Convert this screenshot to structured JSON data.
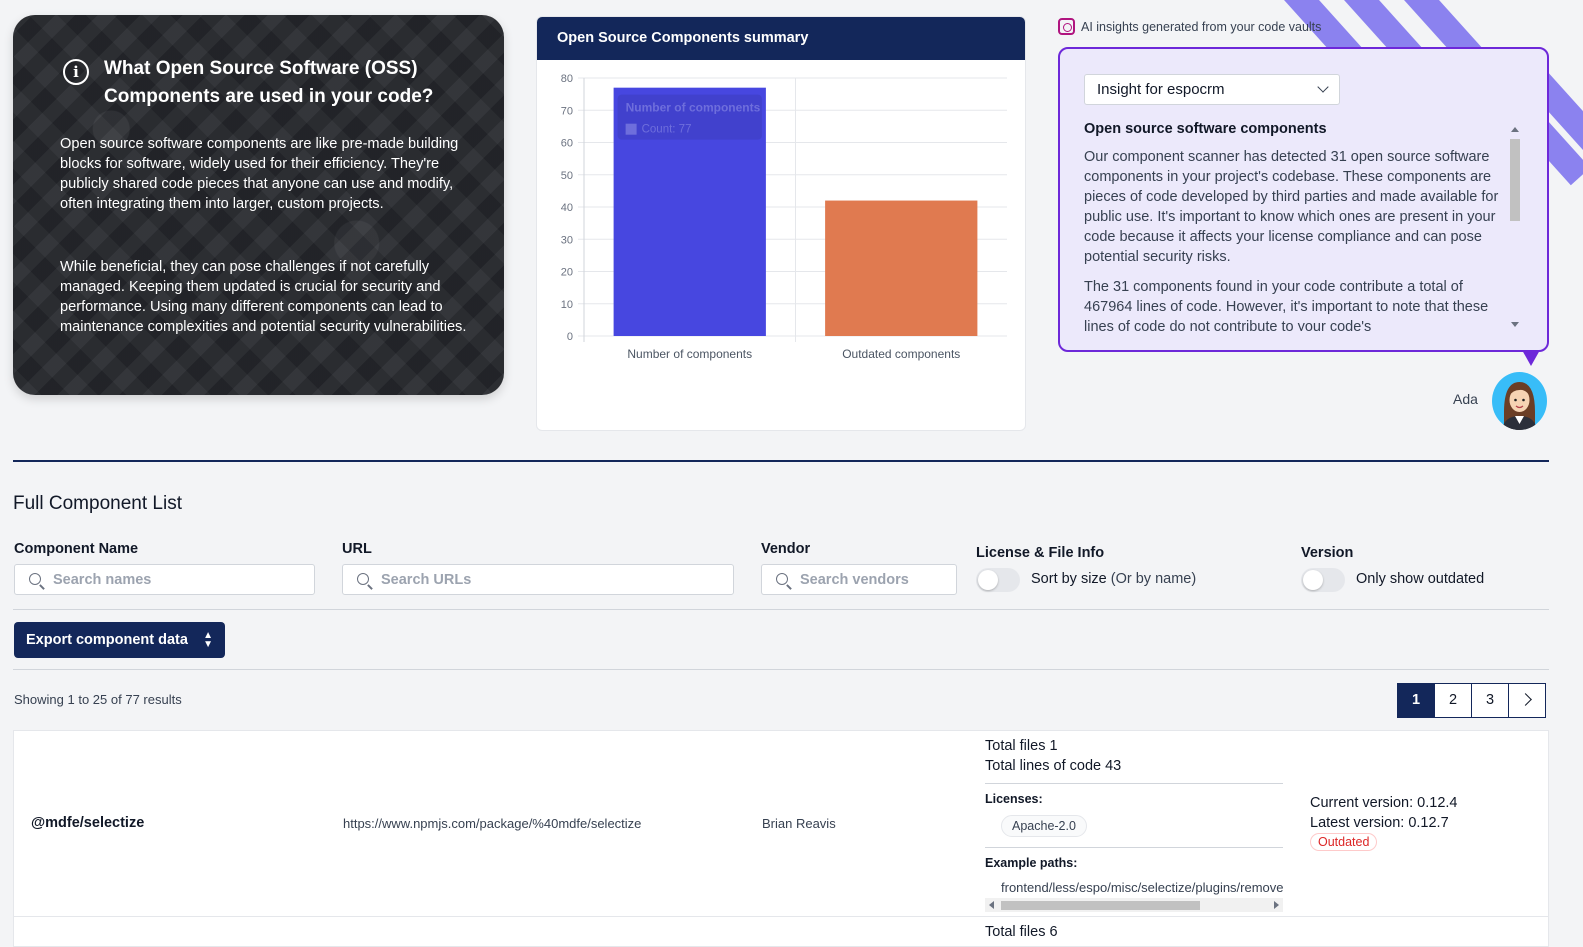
{
  "oss_card": {
    "title": "What Open Source Software (OSS) Components are used in your code?",
    "paragraph1": "Open source software components are like pre-made building blocks for software, widely used for their efficiency. They're publicly shared code pieces that anyone can use and modify, often integrating them into larger, custom projects.",
    "paragraph2": "While beneficial, they can pose challenges if not carefully managed. Keeping them updated is crucial for security and performance. Using many different components can lead to maintenance complexities and potential security vulnerabilities."
  },
  "chart_card": {
    "header": "Open Source Components summary"
  },
  "chart_data": {
    "type": "bar",
    "title": "Open Source Components summary",
    "categories": [
      "Number of components",
      "Outdated components"
    ],
    "values": [
      77,
      42
    ],
    "colors": [
      "#4747e0",
      "#e07a50"
    ],
    "ylim": [
      0,
      80
    ],
    "yticks": [
      0,
      10,
      20,
      30,
      40,
      50,
      60,
      70,
      80
    ],
    "grid": true,
    "tooltip": {
      "title": "Number of components",
      "label": "Count: 77"
    }
  },
  "ai": {
    "label": "AI insights generated from your code vaults",
    "select_value": "Insight for espocrm",
    "heading": "Open source software components",
    "paragraph1": "Our component scanner has detected 31 open source software components in your project's codebase. These components are pieces of code developed by third parties and made available for public use. It's important to know which ones are present in your code because it affects your license compliance and can pose potential security risks.",
    "paragraph2": "The 31 components found in your code contribute a total of 467964 lines of code. However, it's important to note that these lines of code do not contribute to your code's",
    "assistant_name": "Ada"
  },
  "list": {
    "title": "Full Component List",
    "filters": {
      "component_label": "Component Name",
      "component_placeholder": "Search names",
      "url_label": "URL",
      "url_placeholder": "Search URLs",
      "vendor_label": "Vendor",
      "vendor_placeholder": "Search vendors",
      "license_label": "License & File Info",
      "license_toggle": "Sort by size",
      "license_toggle_alt": "(Or by name)",
      "version_label": "Version",
      "version_toggle": "Only show outdated"
    },
    "export_label": "Export component data",
    "showing_prefix": "Showing ",
    "showing_from": "1",
    "showing_mid1": " to ",
    "showing_to": "25",
    "showing_mid2": " of ",
    "showing_total": "77",
    "showing_suffix": " results",
    "pages": [
      "1",
      "2",
      "3"
    ],
    "rows": [
      {
        "name": "@mdfe/selectize",
        "url": "https://www.npmjs.com/package/%40mdfe/selectize",
        "vendor": "Brian Reavis",
        "total_files": "Total files 1",
        "total_lines": "Total lines of code 43",
        "licenses_label": "Licenses:",
        "license": "Apache-2.0",
        "paths_label": "Example paths:",
        "path": "frontend/less/espo/misc/selectize/plugins/remove_button.less",
        "current_version": "Current version: 0.12.4",
        "latest_version": "Latest version: 0.12.7",
        "status": "Outdated"
      },
      {
        "total_files": "Total files 6"
      }
    ]
  }
}
